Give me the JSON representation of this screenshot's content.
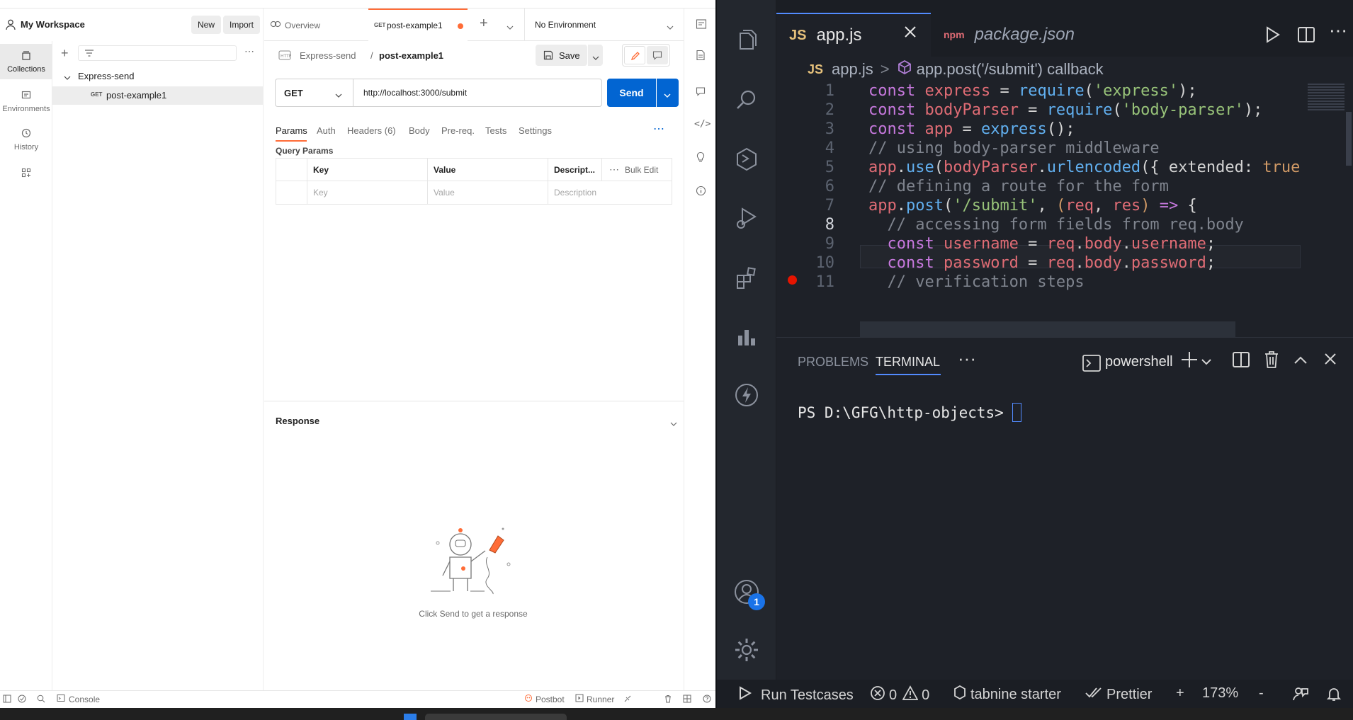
{
  "postman": {
    "workspace": {
      "title": "My Workspace",
      "new_label": "New",
      "import_label": "Import"
    },
    "rail": [
      {
        "label": "Collections",
        "icon": "collections-icon"
      },
      {
        "label": "Environments",
        "icon": "environments-icon"
      },
      {
        "label": "History",
        "icon": "history-icon"
      },
      {
        "label": "",
        "icon": "apps-grid-icon"
      }
    ],
    "tabs": {
      "overview": "Overview",
      "request_method": "GET",
      "request_name": "post-example1",
      "environment": "No Environment"
    },
    "tree": {
      "collection": "Express-send",
      "item_method": "GET",
      "item_name": "post-example1"
    },
    "request": {
      "breadcrumb_collection": "Express-send",
      "breadcrumb_sep": "/",
      "breadcrumb_name": "post-example1",
      "save_label": "Save",
      "method": "GET",
      "url": "http://localhost:3000/submit",
      "send_label": "Send"
    },
    "param_tabs": [
      "Params",
      "Auth",
      "Headers (6)",
      "Body",
      "Pre-req.",
      "Tests",
      "Settings"
    ],
    "query_params": {
      "title": "Query Params",
      "headers": [
        "Key",
        "Value",
        "Descript...",
        "Bulk Edit"
      ],
      "placeholders": [
        "Key",
        "Value",
        "Description"
      ]
    },
    "response": {
      "title": "Response",
      "hint": "Click Send to get a response"
    },
    "status": {
      "console": "Console",
      "postbot": "Postbot",
      "runner": "Runner"
    }
  },
  "vscode": {
    "tabs": [
      {
        "icon": "JS",
        "label": "app.js",
        "active": true
      },
      {
        "icon": "npm",
        "label": "package.json",
        "active": false
      }
    ],
    "breadcrumb": {
      "file_icon": "JS",
      "file": "app.js",
      "sep": ">",
      "symbol": "app.post('/submit') callback"
    },
    "lines": [
      {
        "n": "1",
        "tokens": [
          [
            "k",
            "const "
          ],
          [
            "v",
            "express"
          ],
          [
            "p",
            " = "
          ],
          [
            "f",
            "require"
          ],
          [
            "p",
            "("
          ],
          [
            "s",
            "'express'"
          ],
          [
            "p",
            ");"
          ]
        ]
      },
      {
        "n": "2",
        "tokens": [
          [
            "k",
            "const "
          ],
          [
            "v",
            "bodyParser"
          ],
          [
            "p",
            " = "
          ],
          [
            "f",
            "require"
          ],
          [
            "p",
            "("
          ],
          [
            "s",
            "'body-parser'"
          ],
          [
            "p",
            ");"
          ]
        ]
      },
      {
        "n": "3",
        "tokens": [
          [
            "k",
            "const "
          ],
          [
            "v",
            "app"
          ],
          [
            "p",
            " = "
          ],
          [
            "f",
            "express"
          ],
          [
            "p",
            "();"
          ]
        ]
      },
      {
        "n": "4",
        "tokens": [
          [
            "c",
            "// using body-parser middleware"
          ]
        ]
      },
      {
        "n": "5",
        "tokens": [
          [
            "v",
            "app"
          ],
          [
            "p",
            "."
          ],
          [
            "f",
            "use"
          ],
          [
            "p",
            "("
          ],
          [
            "v",
            "bodyParser"
          ],
          [
            "p",
            "."
          ],
          [
            "f",
            "urlencoded"
          ],
          [
            "p",
            "({ extended: "
          ],
          [
            "n",
            "true"
          ]
        ]
      },
      {
        "n": "6",
        "tokens": [
          [
            "c",
            "// defining a route for the form"
          ]
        ]
      },
      {
        "n": "7",
        "tokens": [
          [
            "v",
            "app"
          ],
          [
            "p",
            "."
          ],
          [
            "f",
            "post"
          ],
          [
            "p",
            "("
          ],
          [
            "s",
            "'/submit'"
          ],
          [
            "p",
            ", "
          ],
          [
            "n",
            "("
          ],
          [
            "v",
            "req"
          ],
          [
            "p",
            ", "
          ],
          [
            "v",
            "res"
          ],
          [
            "n",
            ")"
          ],
          [
            "k",
            " => "
          ],
          [
            "p",
            "{"
          ]
        ]
      },
      {
        "n": "8",
        "tokens": [
          [
            "c",
            "  // accessing form fields from req.body"
          ]
        ]
      },
      {
        "n": "9",
        "tokens": [
          [
            "k",
            "  const "
          ],
          [
            "v",
            "username"
          ],
          [
            "p",
            " = "
          ],
          [
            "v",
            "req"
          ],
          [
            "p",
            "."
          ],
          [
            "v",
            "body"
          ],
          [
            "p",
            "."
          ],
          [
            "v",
            "username"
          ],
          [
            "p",
            ";"
          ]
        ]
      },
      {
        "n": "10",
        "tokens": [
          [
            "k",
            "  const "
          ],
          [
            "v",
            "password"
          ],
          [
            "p",
            " = "
          ],
          [
            "v",
            "req"
          ],
          [
            "p",
            "."
          ],
          [
            "v",
            "body"
          ],
          [
            "p",
            "."
          ],
          [
            "v",
            "password"
          ],
          [
            "p",
            ";"
          ]
        ]
      },
      {
        "n": "11",
        "tokens": [
          [
            "c",
            "  // verification steps"
          ]
        ]
      }
    ],
    "panel": {
      "problems": "PROBLEMS",
      "terminal": "TERMINAL",
      "more": "···",
      "shell": "powershell",
      "prompt": "PS D:\\GFG\\http-objects> "
    },
    "statusbar": {
      "run": "Run Testcases",
      "errors": "0",
      "warnings": "0",
      "tabnine": "tabnine starter",
      "prettier": "Prettier",
      "plus": "+",
      "zoom": "173%",
      "minus": "-"
    },
    "badge": "1"
  },
  "colors": {
    "postman_orange": "#ff6c37",
    "send_blue": "#0265d2",
    "vs_bg": "#1e2128",
    "breakpoint": "#e51400"
  }
}
